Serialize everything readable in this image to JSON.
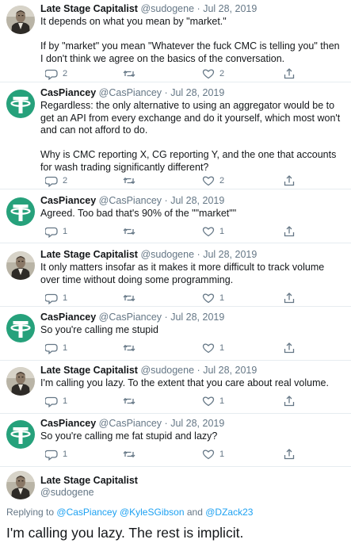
{
  "colors": {
    "accent": "#1da1f2",
    "muted": "#657786",
    "tether_green": "#26a17b"
  },
  "tweets": [
    {
      "name": "Late Stage Capitalist",
      "handle": "@sudogene",
      "dot": "·",
      "date": "Jul 28, 2019",
      "text": "It depends on what you mean by \"market.\"\n\nIf by \"market\" you mean \"Whatever the fuck CMC is telling you\" then I don't think we agree on the basics of the conversation.",
      "replies": "2",
      "retweets": "",
      "likes": "2",
      "avatar": "man-portrait-avatar"
    },
    {
      "name": "CasPiancey",
      "handle": "@CasPiancey",
      "dot": "·",
      "date": "Jul 28, 2019",
      "text": "Regardless: the only alternative to using an aggregator would be to get an API from every exchange and do it yourself, which most won't and can not afford to do.\n\nWhy is CMC reporting X, CG reporting Y, and the one that accounts for wash trading significantly different?",
      "replies": "2",
      "retweets": "",
      "likes": "2",
      "avatar": "tether-logo-avatar"
    },
    {
      "name": "CasPiancey",
      "handle": "@CasPiancey",
      "dot": "·",
      "date": "Jul 28, 2019",
      "text": "Agreed. Too bad that's 90% of the \"\"market\"\"",
      "replies": "1",
      "retweets": "",
      "likes": "1",
      "avatar": "tether-logo-avatar"
    },
    {
      "name": "Late Stage Capitalist",
      "handle": "@sudogene",
      "dot": "·",
      "date": "Jul 28, 2019",
      "text": "It only matters insofar as it makes it more difficult to track volume over time without doing some programming.",
      "replies": "1",
      "retweets": "",
      "likes": "1",
      "avatar": "man-portrait-avatar"
    },
    {
      "name": "CasPiancey",
      "handle": "@CasPiancey",
      "dot": "·",
      "date": "Jul 28, 2019",
      "text": "So you're calling me stupid",
      "replies": "1",
      "retweets": "",
      "likes": "1",
      "avatar": "tether-logo-avatar"
    },
    {
      "name": "Late Stage Capitalist",
      "handle": "@sudogene",
      "dot": "·",
      "date": "Jul 28, 2019",
      "text": "I'm calling you lazy. To the extent that you care about real volume.",
      "replies": "1",
      "retweets": "",
      "likes": "1",
      "avatar": "man-portrait-avatar"
    },
    {
      "name": "CasPiancey",
      "handle": "@CasPiancey",
      "dot": "·",
      "date": "Jul 28, 2019",
      "text": "So you're calling me fat stupid and lazy?",
      "replies": "1",
      "retweets": "",
      "likes": "1",
      "avatar": "tether-logo-avatar"
    }
  ],
  "final_tweet": {
    "name": "Late Stage Capitalist",
    "handle": "@sudogene",
    "replying_prefix": "Replying to",
    "mention_1": "@CasPiancey",
    "mention_2": "@KyleSGibson",
    "and_word": "and",
    "mention_3": "@DZack23",
    "text": "I'm calling you lazy. The rest is implicit."
  }
}
